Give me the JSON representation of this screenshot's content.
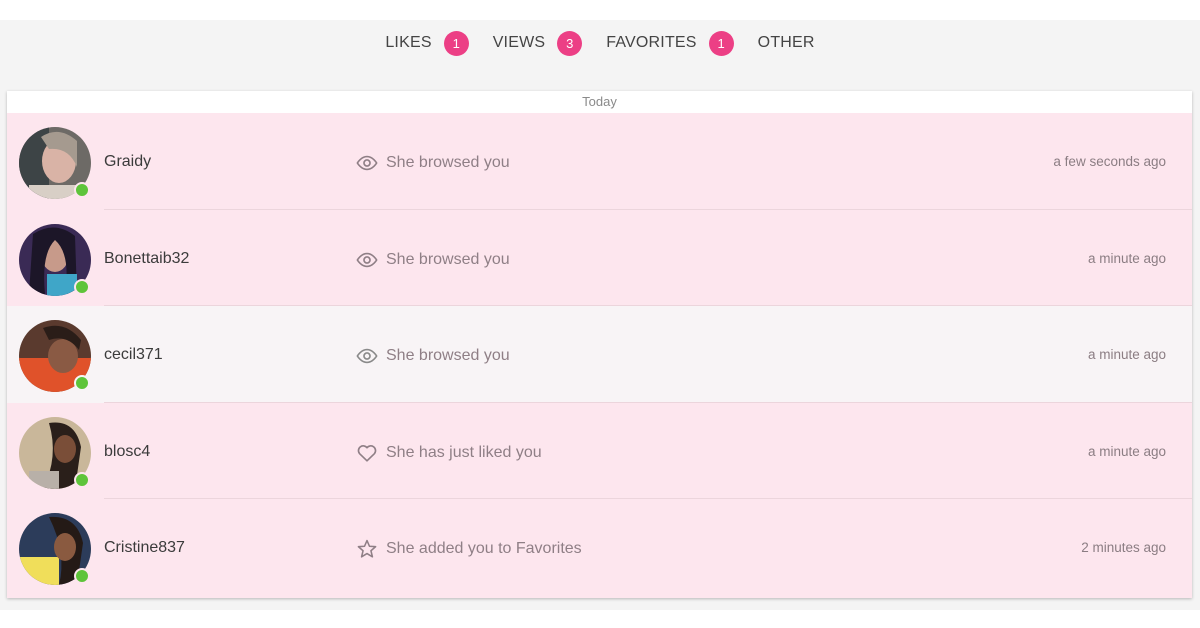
{
  "tabs": [
    {
      "label": "LIKES",
      "count": "1"
    },
    {
      "label": "VIEWS",
      "count": "3"
    },
    {
      "label": "FAVORITES",
      "count": "1"
    },
    {
      "label": "OTHER",
      "count": null
    }
  ],
  "colors": {
    "badge": "#ec3f85",
    "unread_row": "#fde6ee",
    "read_row": "#f8f4f6",
    "online": "#5ec43a"
  },
  "feed": {
    "group_label": "Today",
    "items": [
      {
        "username": "Graidy",
        "action_icon": "eye-icon",
        "action": "She browsed you",
        "time": "a few seconds ago",
        "online": true,
        "read": false
      },
      {
        "username": "Bonettaib32",
        "action_icon": "eye-icon",
        "action": "She browsed you",
        "time": "a minute ago",
        "online": true,
        "read": false
      },
      {
        "username": "cecil371",
        "action_icon": "eye-icon",
        "action": "She browsed you",
        "time": "a minute ago",
        "online": true,
        "read": true
      },
      {
        "username": "blosc4",
        "action_icon": "heart-icon",
        "action": "She has just liked you",
        "time": "a minute ago",
        "online": true,
        "read": false
      },
      {
        "username": "Cristine837",
        "action_icon": "star-icon",
        "action": "She added you to Favorites",
        "time": "2 minutes ago",
        "online": true,
        "read": false
      }
    ]
  }
}
